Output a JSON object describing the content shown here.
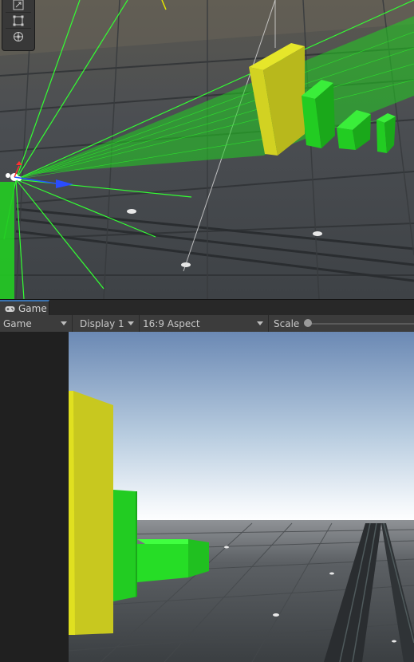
{
  "game_panel": {
    "tab_label": "Game",
    "toolbar": {
      "view_mode": "Game",
      "display": "Display 1",
      "aspect": "16:9 Aspect",
      "scale_label": "Scale"
    }
  },
  "icons": {
    "tab_icon": "gamepad-icon",
    "tools": [
      "scale-tool-icon",
      "rect-tool-icon",
      "transform-tool-icon"
    ]
  },
  "colors": {
    "panel_bg": "#202020",
    "toolbar_bg": "#3c3c3c",
    "gizmo_green": "#20ff20",
    "yellow_block": "#cccc22",
    "green_block": "#22cc22"
  }
}
